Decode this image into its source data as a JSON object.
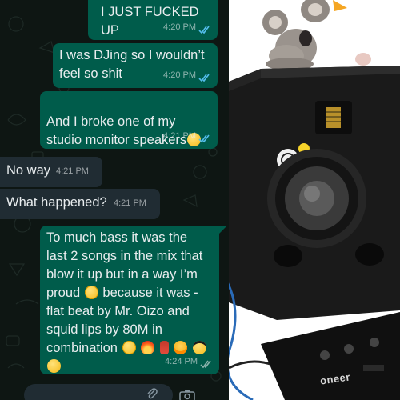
{
  "messages": [
    {
      "direction": "out",
      "text": "I JUST FUCKED UP",
      "time": "4:20 PM",
      "status": "read"
    },
    {
      "direction": "out",
      "text": "I was DJing so I wouldn’t\nfeel so shit",
      "time": "4:20 PM",
      "status": "read"
    },
    {
      "direction": "out",
      "text": "And I broke one of my\nstudio monitor speakers",
      "time": "4:21 PM",
      "status": "read"
    },
    {
      "direction": "in",
      "text": "No way",
      "time": "4:21 PM"
    },
    {
      "direction": "in",
      "text": "What happened?",
      "time": "4:21 PM"
    },
    {
      "direction": "out",
      "lines": [
        "To much bass it was the",
        "last 2 songs in the mix that",
        "blow it up but in a way I’m",
        "proud",
        "because it was -",
        "flat beat  by Mr. Oizo and",
        "squid lips by 80M in",
        "combination"
      ],
      "time": "4:24 PM",
      "status": "sent"
    }
  ],
  "photo": {
    "brand_text": "oneer"
  },
  "colors": {
    "chat_background": "#0e1613",
    "outgoing_bubble": "#005c4b",
    "incoming_bubble": "#202c33",
    "read_tick": "#53bdeb",
    "text": "#e9edef"
  },
  "icons": [
    "double-check-icon",
    "paperclip-icon",
    "camera-icon",
    "emoji-pleading-icon",
    "emoji-fire-icon",
    "emoji-fire-extinguisher-icon",
    "emoji-exploding-head-icon",
    "emoji-sunglasses-icon",
    "emoji-sad-icon"
  ]
}
